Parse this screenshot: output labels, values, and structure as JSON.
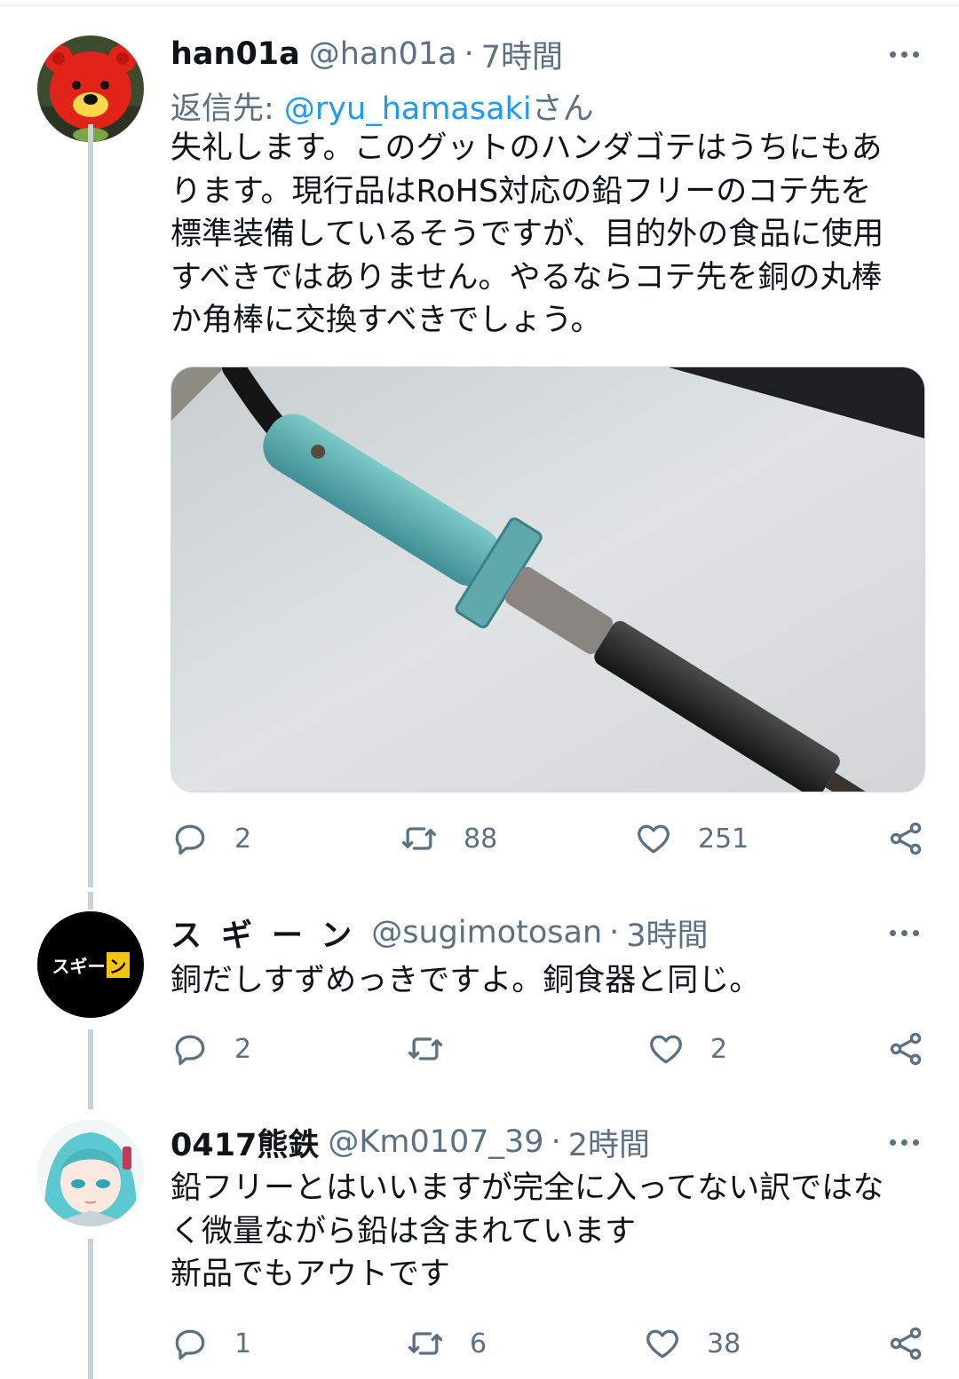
{
  "tweets": [
    {
      "name": "han01a",
      "handle": "@han01a",
      "separator": "·",
      "time": "7時間",
      "reply_prefix": "返信先: ",
      "reply_mention": "@ryu_hamasaki",
      "reply_suffix": "さん",
      "body_lines": [
        "失礼します。このグットのハンダゴテはうちにもあ",
        "ります。現行品はRoHS対応の鉛フリーのコテ先を",
        "標準装備しているそうですが、目的外の食品に使用",
        "すべきではありません。やるならコテ先を銅の丸棒",
        "か角棒に交換すべきでしょう。"
      ],
      "replies": "2",
      "retweets": "88",
      "likes": "251"
    },
    {
      "name": "スギーン",
      "avatar_text": "スギー",
      "avatar_mark": "ン",
      "handle": "@sugimotosan",
      "separator": "·",
      "time": "3時間",
      "body_lines": [
        "銅だしすずめっきですよ。銅食器と同じ。"
      ],
      "replies": "2",
      "retweets": "",
      "likes": "2"
    },
    {
      "name": "0417熊鉄",
      "handle": "@Km0107_39",
      "separator": "·",
      "time": "2時間",
      "body_lines": [
        "鉛フリーとはいいますが完全に入ってない訳ではな",
        "く微量ながら鉛は含まれています",
        "新品でもアウトです"
      ],
      "replies": "1",
      "retweets": "6",
      "likes": "38"
    }
  ],
  "icons": {
    "reply": "reply-icon",
    "retweet": "retweet-icon",
    "like": "heart-icon",
    "share": "share-icon",
    "more": "more-icon"
  },
  "colors": {
    "text": "#0f1419",
    "secondary": "#5b7083",
    "link": "#1d9bf0",
    "thread_line": "#c9d2d9",
    "border": "#cfd9de"
  }
}
